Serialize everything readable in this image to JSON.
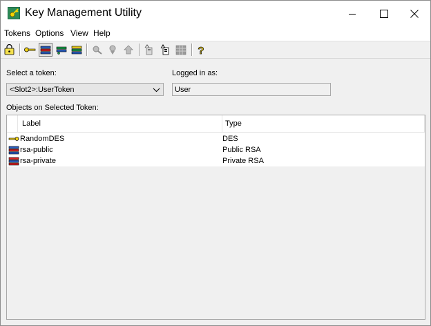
{
  "window": {
    "title": "Key Management Utility"
  },
  "menu": [
    "Tokens",
    "Options",
    "View",
    "Help"
  ],
  "toolbar": {
    "icons": [
      "login-icon",
      "key-yellow-icon",
      "key-blue-red-icon",
      "key-green-icon",
      "key-yellow-green-icon",
      "find-icon",
      "import-icon",
      "export-icon",
      "token-up-icon",
      "token-info-icon",
      "token-grid-icon",
      "help-icon"
    ]
  },
  "token": {
    "label": "Select a token:",
    "selected": "<Slot2>:UserToken"
  },
  "login": {
    "label": "Logged in as:",
    "value": "User"
  },
  "objects": {
    "label": "Objects on Selected Token:",
    "columns": [
      "Label",
      "Type"
    ],
    "rows": [
      {
        "label": "RandomDES",
        "type": "DES",
        "icon": "secret-key-icon"
      },
      {
        "label": "rsa-public",
        "type": "Public RSA",
        "icon": "public-key-icon"
      },
      {
        "label": "rsa-private",
        "type": "Private RSA",
        "icon": "private-key-icon"
      }
    ]
  }
}
